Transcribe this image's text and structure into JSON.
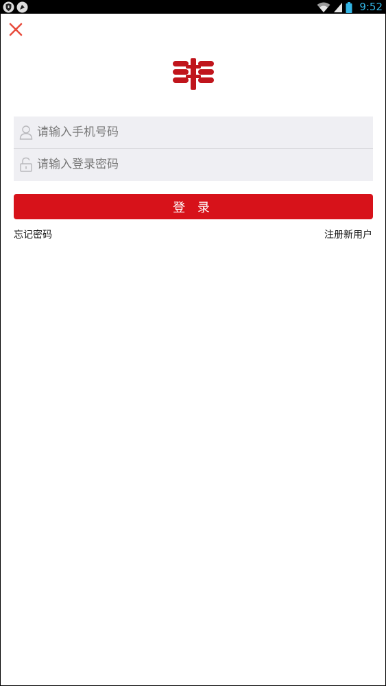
{
  "status_bar": {
    "time": "9:52",
    "icons": [
      "shield-notification-icon",
      "signal-app-icon",
      "wifi-icon",
      "cellular-signal-icon",
      "battery-icon"
    ],
    "time_color": "#33b5e5"
  },
  "header": {
    "close_icon": "close-icon",
    "close_color": "#e84c3d"
  },
  "logo": {
    "icon": "brand-logo-icon",
    "color": "#c0151c"
  },
  "form": {
    "phone": {
      "icon": "user-icon",
      "placeholder": "请输入手机号码",
      "value": ""
    },
    "password": {
      "icon": "lock-icon",
      "placeholder": "请输入登录密码",
      "value": ""
    }
  },
  "login_button": {
    "label": "登 录",
    "color": "#d7121a"
  },
  "links": {
    "forgot_password": "忘记密码",
    "register": "注册新用户"
  }
}
